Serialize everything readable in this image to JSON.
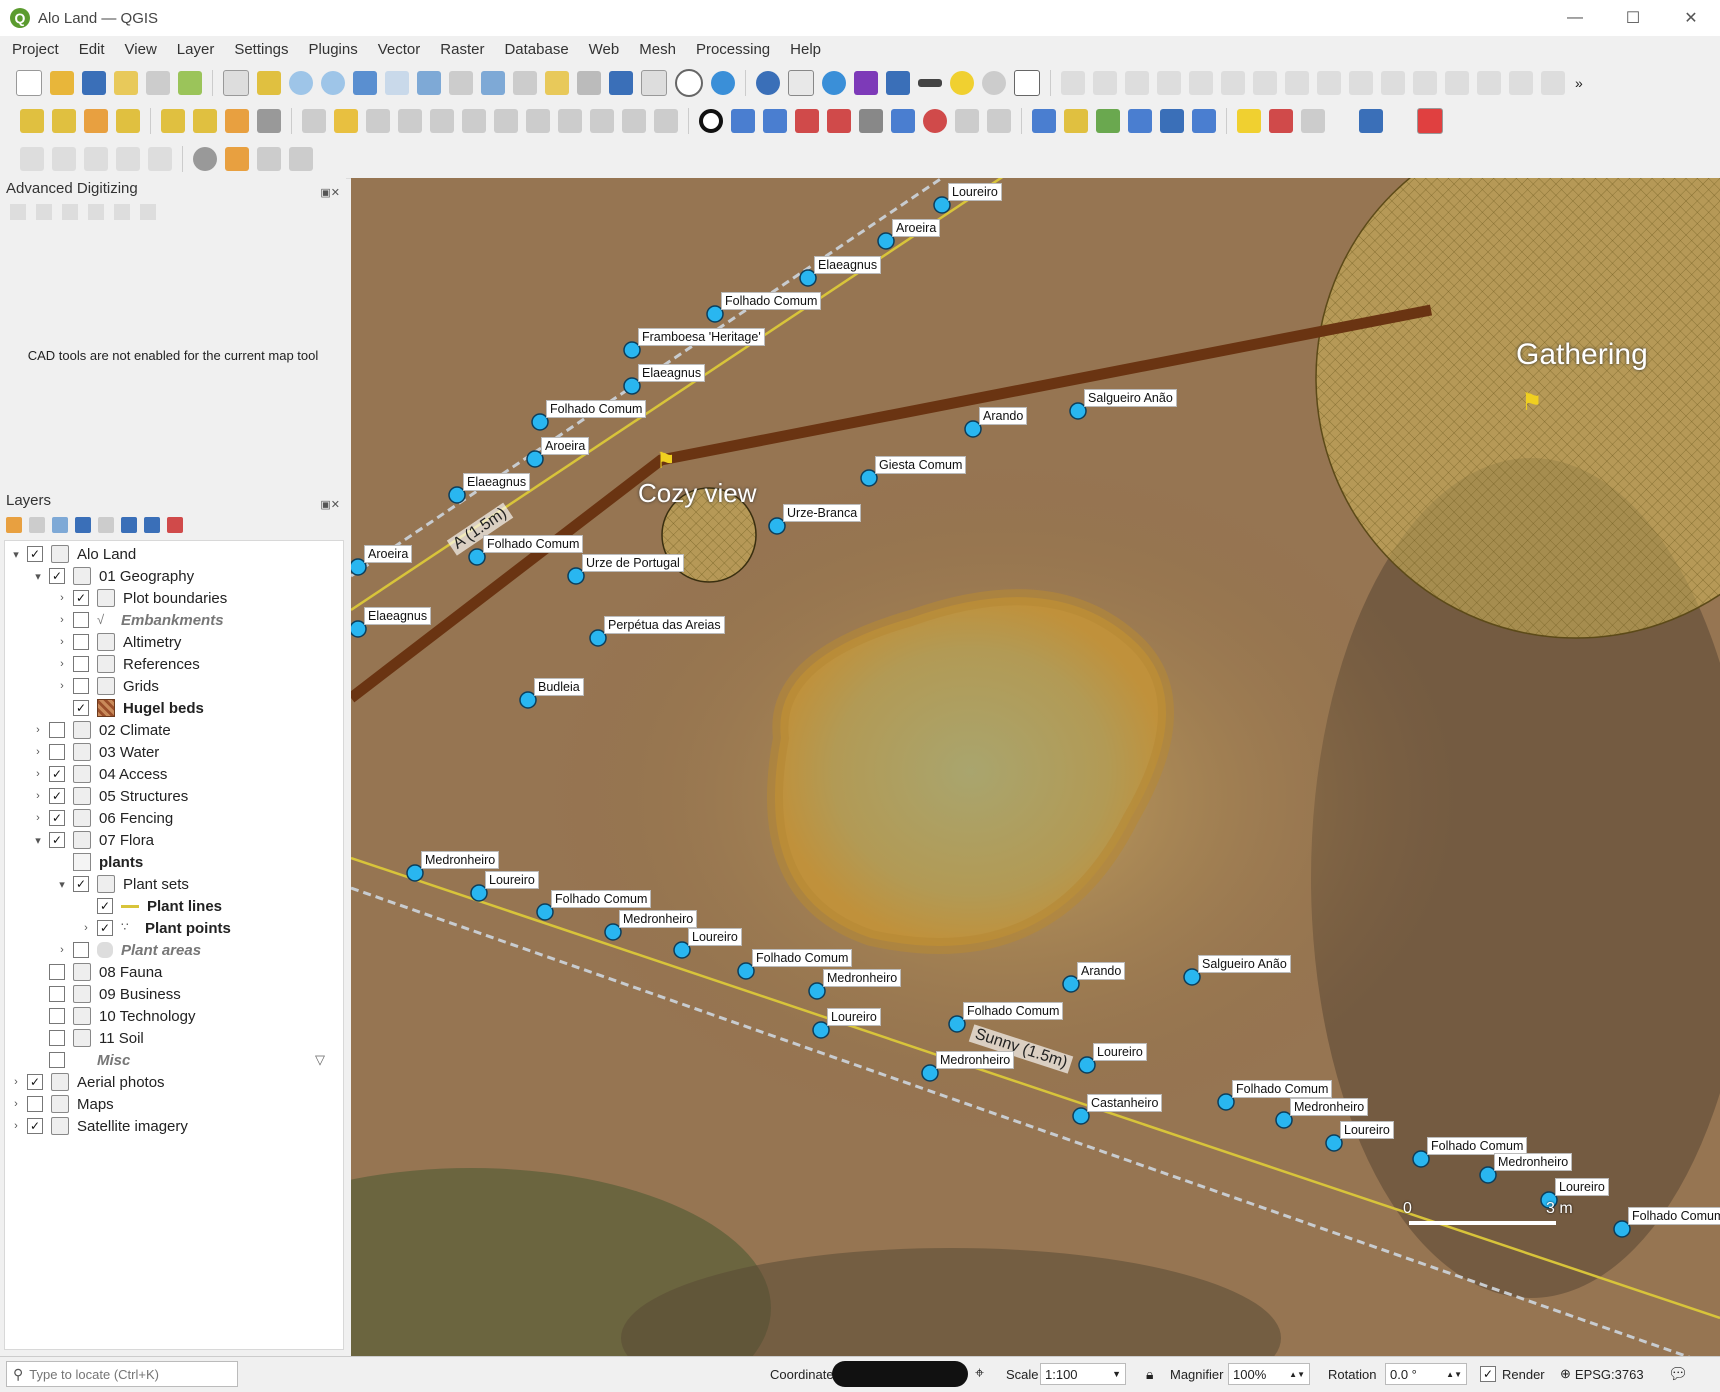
{
  "window": {
    "title": "Alo Land — QGIS",
    "minimize": "—",
    "maximize": "☐",
    "close": "✕"
  },
  "menu": [
    "Project",
    "Edit",
    "View",
    "Layer",
    "Settings",
    "Plugins",
    "Vector",
    "Raster",
    "Database",
    "Web",
    "Mesh",
    "Processing",
    "Help"
  ],
  "toolbar_overflow": "»",
  "advanced_digitizing": {
    "title": "Advanced Digitizing",
    "message": "CAD tools are not enabled for the current map tool"
  },
  "layers_panel": {
    "title": "Layers",
    "tree": [
      {
        "label": "Alo Land",
        "checked": true
      },
      {
        "label": "01 Geography",
        "checked": true
      },
      {
        "label": "Plot boundaries",
        "checked": true
      },
      {
        "label": "Embankments",
        "checked": false
      },
      {
        "label": "Altimetry",
        "checked": false
      },
      {
        "label": "References",
        "checked": false
      },
      {
        "label": "Grids",
        "checked": false
      },
      {
        "label": "Hugel beds",
        "checked": true
      },
      {
        "label": "02 Climate",
        "checked": false
      },
      {
        "label": "03 Water",
        "checked": false
      },
      {
        "label": "04 Access",
        "checked": true
      },
      {
        "label": "05 Structures",
        "checked": true
      },
      {
        "label": "06 Fencing",
        "checked": true
      },
      {
        "label": "07 Flora",
        "checked": true
      },
      {
        "label": "plants",
        "checked": null
      },
      {
        "label": "Plant sets",
        "checked": true
      },
      {
        "label": "Plant lines",
        "checked": true
      },
      {
        "label": "Plant points",
        "checked": true
      },
      {
        "label": "Plant areas",
        "checked": false
      },
      {
        "label": "08 Fauna",
        "checked": false
      },
      {
        "label": "09 Business",
        "checked": false
      },
      {
        "label": "10 Technology",
        "checked": false
      },
      {
        "label": "11 Soil",
        "checked": false
      },
      {
        "label": "Misc",
        "checked": false
      },
      {
        "label": "Aerial photos",
        "checked": true
      },
      {
        "label": "Maps",
        "checked": false
      },
      {
        "label": "Satellite imagery",
        "checked": true
      }
    ]
  },
  "map": {
    "areas": {
      "gathering": "Gathering",
      "cozy": "Cozy view"
    },
    "lines": {
      "a": "A (1.5m)",
      "sunny": "Sunny (1.5m)"
    },
    "scalebar": {
      "zero": "0",
      "end": "3 m"
    },
    "plants_top_line": [
      "Loureiro",
      "Aroeira",
      "Elaeagnus",
      "Folhado Comum",
      "Framboesa 'Heritage'",
      "Elaeagnus",
      "Folhado Comum",
      "Aroeira",
      "Elaeagnus",
      "Folhado Comum",
      "Aroeira",
      "Elaeagnus"
    ],
    "plants_scattered": [
      "Arando",
      "Salgueiro Anão",
      "Giesta Comum",
      "Urze-Branca",
      "Urze de Portugal",
      "Perpétua das Areias",
      "Budleia"
    ],
    "plants_bottom_line": [
      "Medronheiro",
      "Loureiro",
      "Folhado Comum",
      "Medronheiro",
      "Loureiro",
      "Folhado Comum",
      "Medronheiro",
      "Loureiro",
      "Folhado Comum",
      "Medronheiro",
      "Loureiro",
      "Castanheiro",
      "Folhado Comum",
      "Medronheiro",
      "Loureiro",
      "Folhado Comum",
      "Medronheiro",
      "Loureiro",
      "Folhado Comum"
    ],
    "plants_bottom_scattered": [
      "Arando",
      "Salgueiro Anão"
    ]
  },
  "status": {
    "locate_placeholder": "Type to locate (Ctrl+K)",
    "coordinate_label": "Coordinate",
    "scale_label": "Scale",
    "scale_value": "1:100",
    "magnifier_label": "Magnifier",
    "magnifier_value": "100%",
    "rotation_label": "Rotation",
    "rotation_value": "0.0 °",
    "render_label": "Render",
    "render_checked": true,
    "crs": "EPSG:3763"
  }
}
